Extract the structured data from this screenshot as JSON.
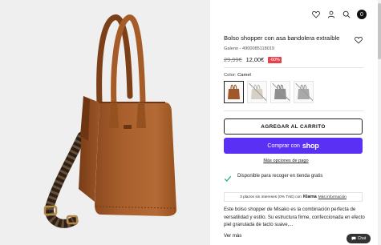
{
  "product": {
    "title": "Bolso shopper con asa bandolera extraíble",
    "sku": "Galeno - 4900085118019",
    "old_price": "29,99€",
    "new_price": "12,00€",
    "discount": "-60%",
    "color_label": "Color:",
    "color_value": "Camel",
    "swatches": [
      {
        "name": "Camel",
        "color": "#a0582a",
        "selected": true
      },
      {
        "name": "Beige",
        "color": "#d8cfc6",
        "selected": false
      },
      {
        "name": "Gris",
        "color": "#8f8f8f",
        "selected": false
      },
      {
        "name": "Gris claro",
        "color": "#a9a9a9",
        "selected": false
      }
    ],
    "description": "Este bolso shopper de Misako es la combinación perfecta de versatilidad y estilo. Su estructura firme, confeccionada en efecto piel granulada de tacto suave,...",
    "see_more": "Ver más"
  },
  "actions": {
    "add_to_cart": "AGREGAR AL CARRITO",
    "shop_pay_label": "Comprar con",
    "shop_brand": "shop",
    "more_payment": "Más opciones de pago"
  },
  "pickup": {
    "text": "Disponible para recoger en tienda gratis"
  },
  "klarna": {
    "prefix": "3 plazos sin intereses (0% TAE) con",
    "brand": "Klarna",
    "more": "Más información"
  },
  "header": {
    "cart_count": "0"
  },
  "chat": {
    "label": "Chat"
  },
  "colors": {
    "accent_shop": "#5a31f4",
    "discount": "#e4434d",
    "check": "#2fae8c"
  }
}
